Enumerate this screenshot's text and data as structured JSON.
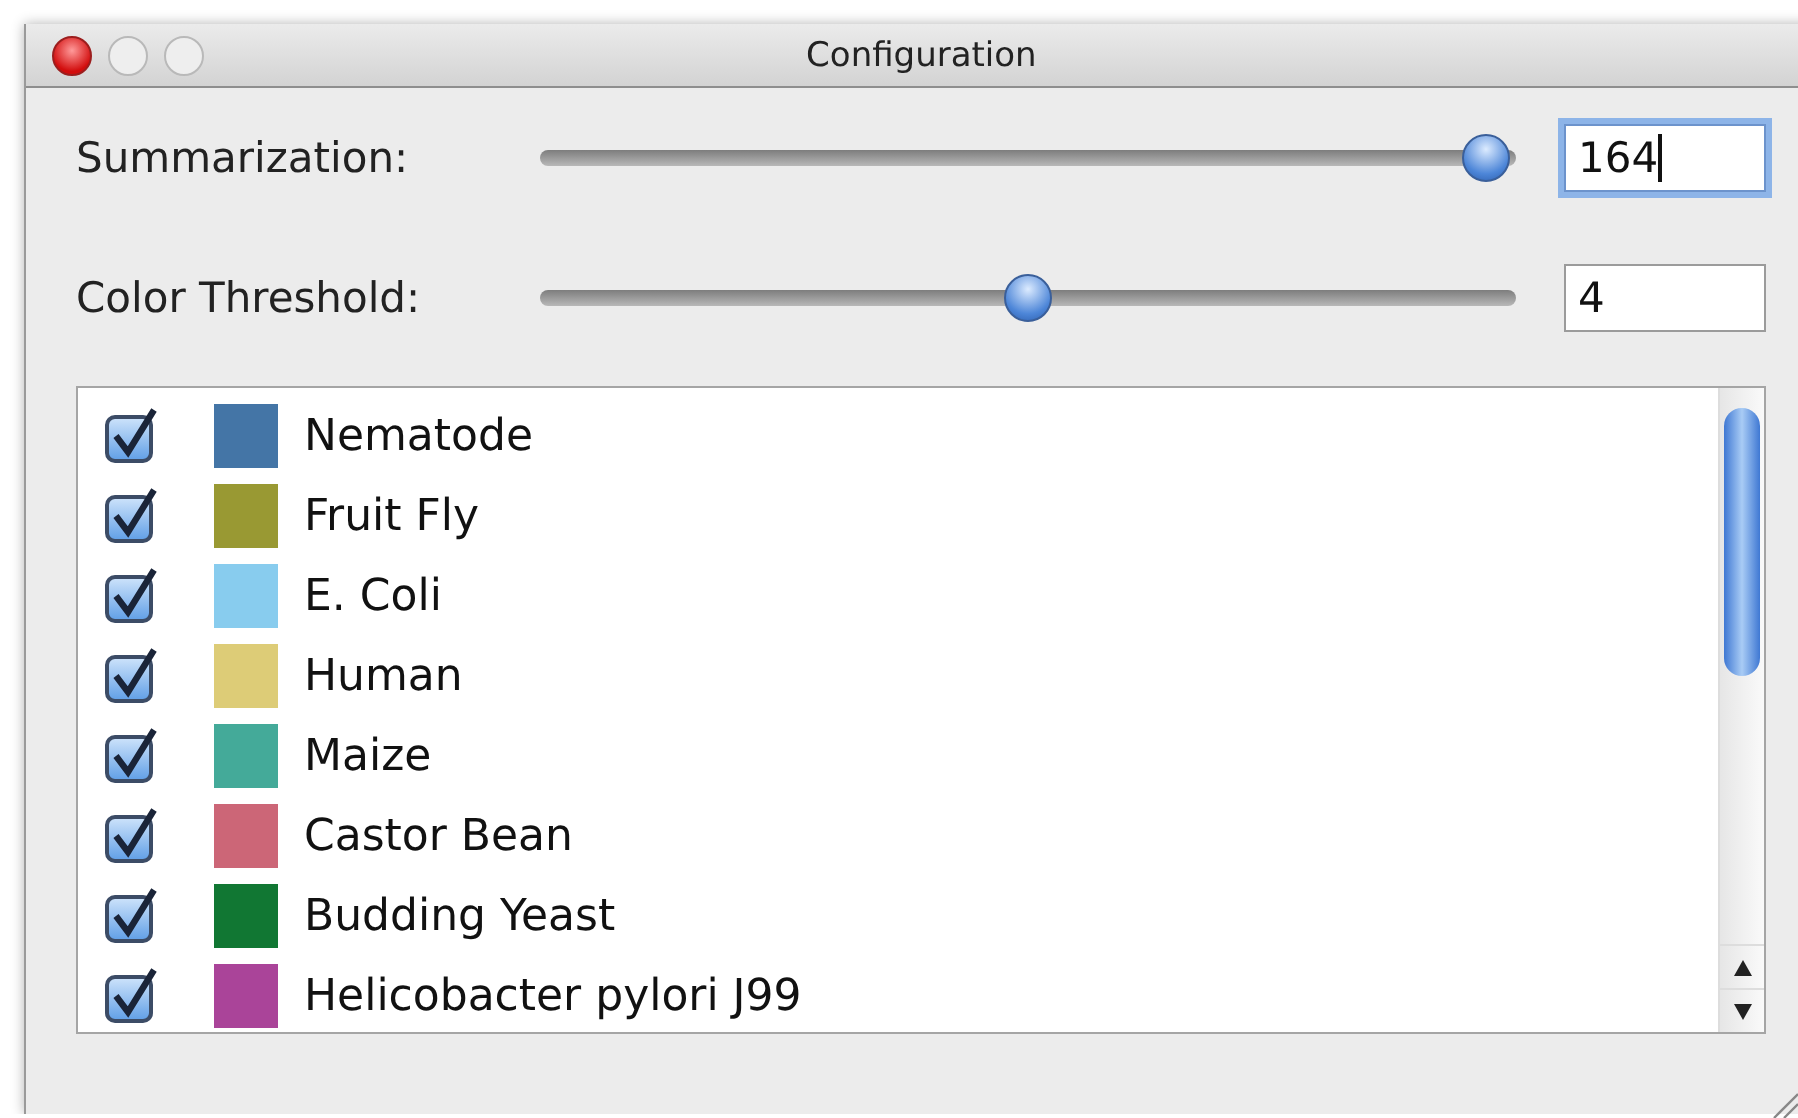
{
  "window": {
    "title": "Configuration"
  },
  "settings": [
    {
      "label": "Summarization:",
      "level": 0.97,
      "value": "164",
      "focused": true
    },
    {
      "label": "Color Threshold:",
      "level": 0.5,
      "value": "4",
      "focused": false
    }
  ],
  "organisms": [
    {
      "name": "Nematode",
      "checked": true,
      "color": "#4475a6"
    },
    {
      "name": "Fruit Fly",
      "checked": true,
      "color": "#999933"
    },
    {
      "name": "E. Coli",
      "checked": true,
      "color": "#88ccee"
    },
    {
      "name": "Human",
      "checked": true,
      "color": "#ddcc77"
    },
    {
      "name": "Maize",
      "checked": true,
      "color": "#44aa99"
    },
    {
      "name": "Castor Bean",
      "checked": true,
      "color": "#cc6677"
    },
    {
      "name": "Budding Yeast",
      "checked": true,
      "color": "#117733"
    },
    {
      "name": "Helicobacter pylori J99",
      "checked": true,
      "color": "#aa4499"
    }
  ]
}
